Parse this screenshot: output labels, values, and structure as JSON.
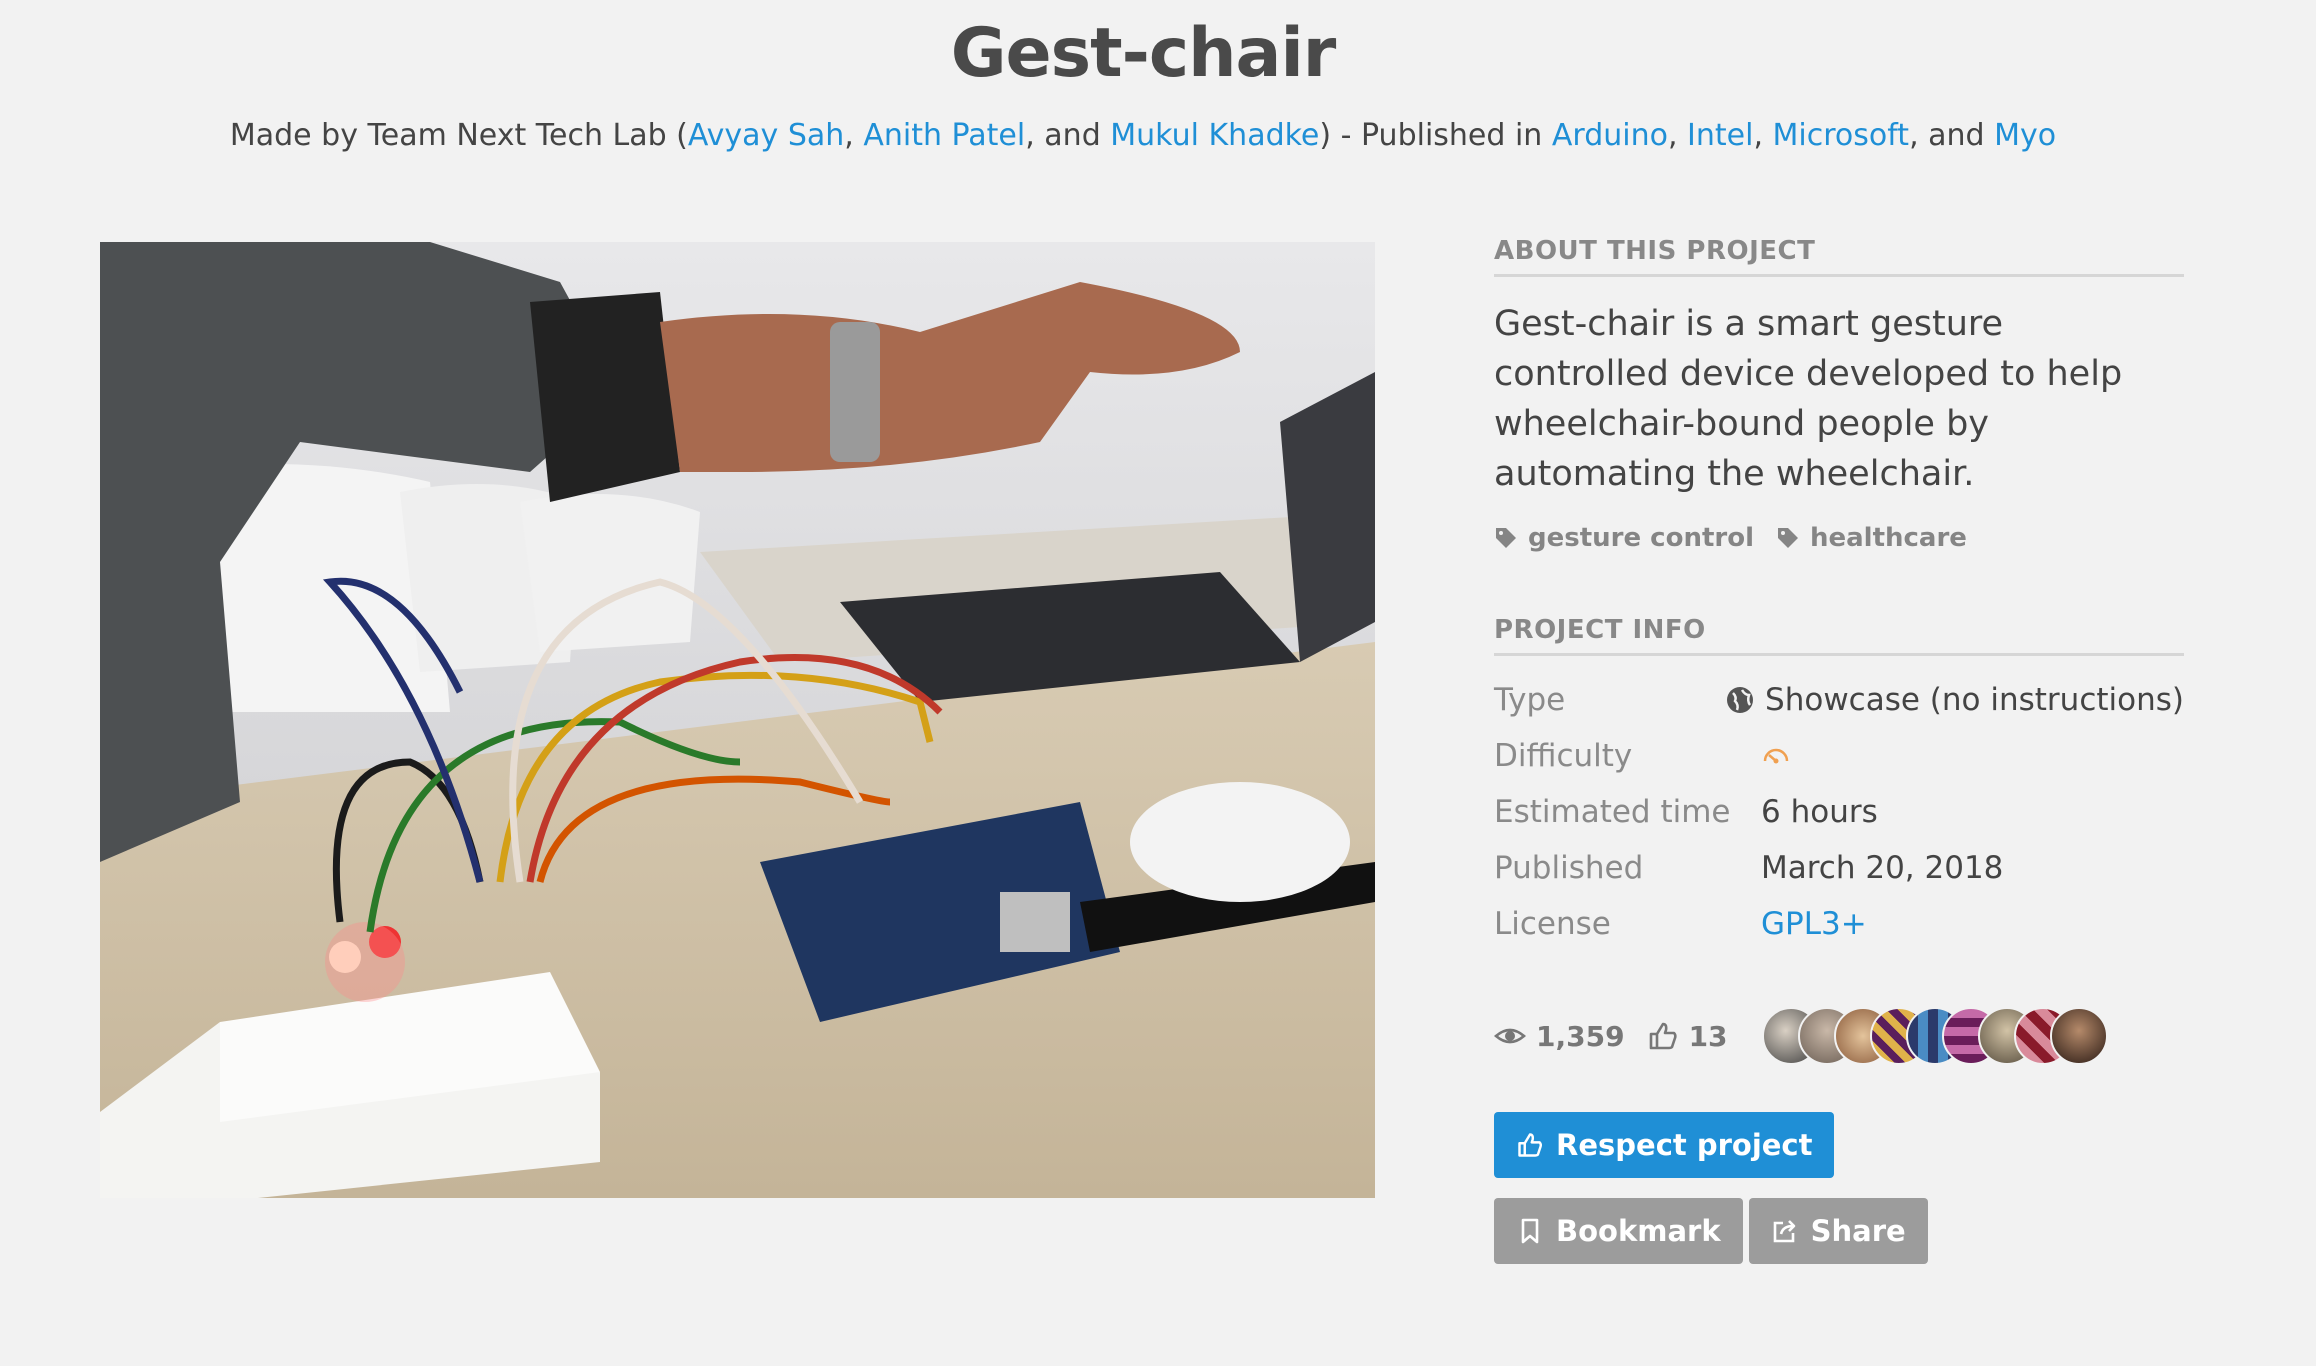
{
  "project": {
    "title": "Gest-chair",
    "byline": {
      "prefix": "Made by Team Next Tech Lab (",
      "authors": [
        "Avyay Sah",
        "Anith Patel",
        "Mukul Khadke"
      ],
      "sep1": ", ",
      "sep2": ", and ",
      "middle": ") - Published in ",
      "platforms": [
        "Arduino",
        "Intel",
        "Microsoft",
        "Myo"
      ],
      "psep": ", ",
      "pand": ", and "
    }
  },
  "about": {
    "heading": "ABOUT THIS PROJECT",
    "description": "Gest-chair is a smart gesture controlled device developed to help wheelchair-bound people by automating the wheelchair.",
    "tags": [
      "gesture control",
      "healthcare"
    ]
  },
  "info": {
    "heading": "PROJECT INFO",
    "rows": [
      {
        "key": "Type",
        "value": "Showcase (no instructions)",
        "icon": "globe-icon"
      },
      {
        "key": "Difficulty",
        "value": "",
        "icon": "difficulty-easy-icon"
      },
      {
        "key": "Estimated time",
        "value": "6 hours"
      },
      {
        "key": "Published",
        "value": "March 20, 2018"
      },
      {
        "key": "License",
        "value": "GPL3+",
        "link": true
      }
    ]
  },
  "stats": {
    "views": "1,359",
    "respects": "13",
    "avatar_count": 9
  },
  "actions": {
    "respect": "Respect project",
    "bookmark": "Bookmark",
    "share": "Share"
  },
  "colors": {
    "link": "#1f8fd6",
    "background": "#f2f2f2",
    "button_primary": "#1f8fd6",
    "button_grey": "#9c9c9c",
    "difficulty": "#f0a050"
  }
}
